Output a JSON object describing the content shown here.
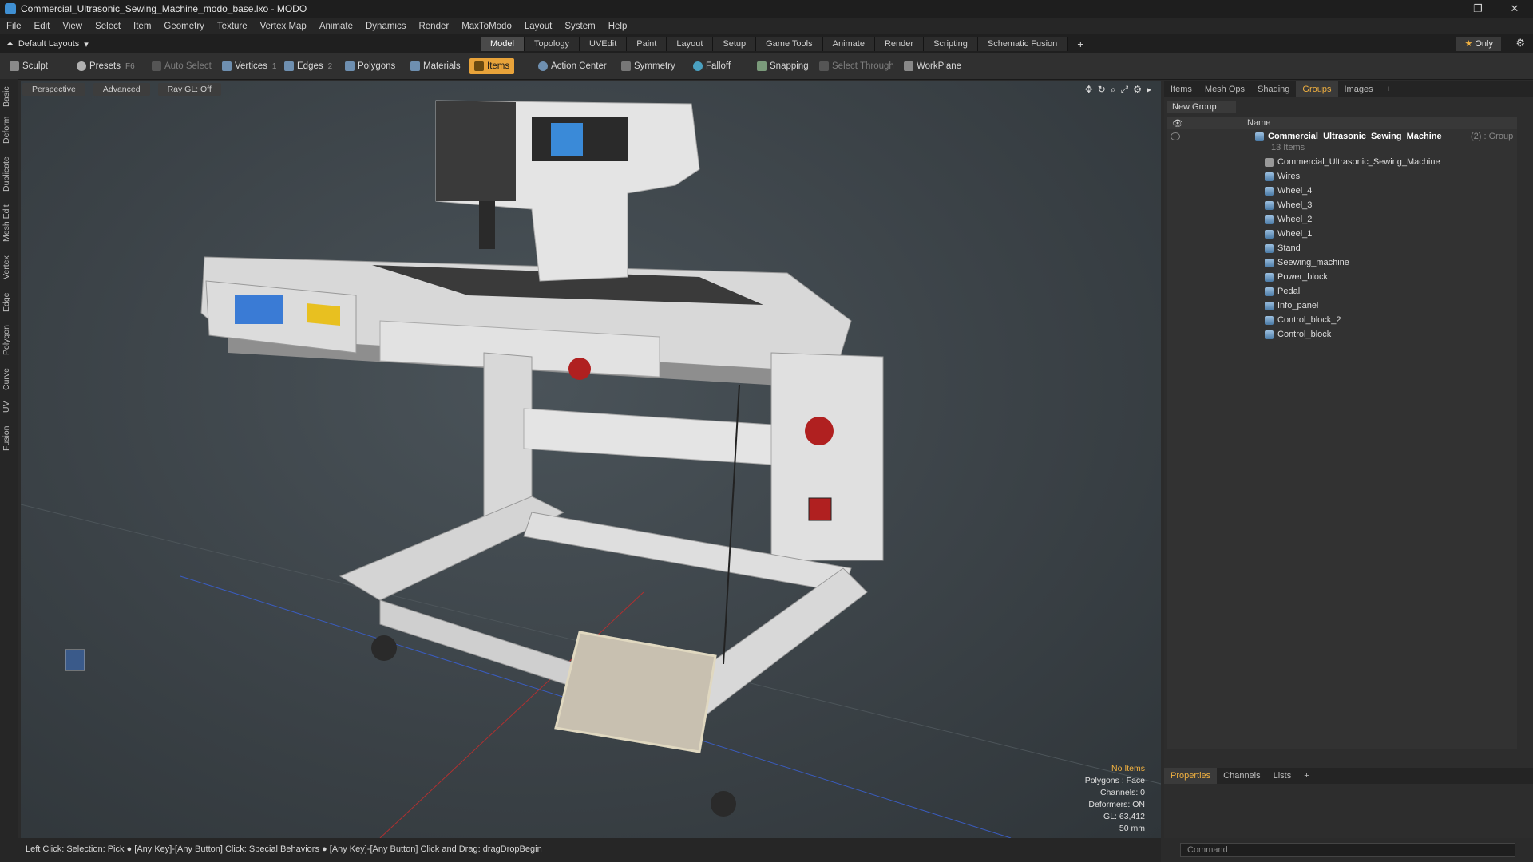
{
  "window": {
    "title": "Commercial_Ultrasonic_Sewing_Machine_modo_base.lxo - MODO"
  },
  "menu": [
    "File",
    "Edit",
    "View",
    "Select",
    "Item",
    "Geometry",
    "Texture",
    "Vertex Map",
    "Animate",
    "Dynamics",
    "Render",
    "MaxToModo",
    "Layout",
    "System",
    "Help"
  ],
  "layout": {
    "selector": "Default Layouts",
    "tabs": [
      "Model",
      "Topology",
      "UVEdit",
      "Paint",
      "Layout",
      "Setup",
      "Game Tools",
      "Animate",
      "Render",
      "Scripting",
      "Schematic Fusion"
    ],
    "active_tab": "Model",
    "only_label": "Only"
  },
  "toolbar": {
    "sculpt": "Sculpt",
    "presets": "Presets",
    "presets_key": "F6",
    "auto_select": "Auto Select",
    "vertices": "Vertices",
    "vertices_key": "1",
    "edges": "Edges",
    "edges_key": "2",
    "polygons": "Polygons",
    "materials": "Materials",
    "items": "Items",
    "action_center": "Action Center",
    "symmetry": "Symmetry",
    "falloff": "Falloff",
    "snapping": "Snapping",
    "select_through": "Select Through",
    "workplane": "WorkPlane"
  },
  "left_tabs": [
    "Basic",
    "Deform",
    "Duplicate",
    "Mesh Edit",
    "Vertex",
    "Edge",
    "Polygon",
    "Curve",
    "UV",
    "Fusion"
  ],
  "viewport": {
    "view": "Perspective",
    "shading": "Advanced",
    "raygl": "Ray GL: Off",
    "info": {
      "no_items": "No Items",
      "polygons": "Polygons : Face",
      "channels": "Channels: 0",
      "deformers": "Deformers: ON",
      "gl": "GL: 63,412",
      "scale": "50 mm"
    }
  },
  "status": "Left Click: Selection: Pick ● [Any Key]-[Any Button] Click: Special Behaviors ● [Any Key]-[Any Button] Click and Drag: dragDropBegin",
  "panel": {
    "tabs": [
      "Items",
      "Mesh Ops",
      "Shading",
      "Groups",
      "Images"
    ],
    "active_tab": "Groups",
    "new_group": "New Group",
    "name_col": "Name",
    "group_name": "Commercial_Ultrasonic_Sewing_Machine",
    "group_suffix": "(2) : Group",
    "group_count": "13 Items",
    "items": [
      "Commercial_Ultrasonic_Sewing_Machine",
      "Wires",
      "Wheel_4",
      "Wheel_3",
      "Wheel_2",
      "Wheel_1",
      "Stand",
      "Seewing_machine",
      "Power_block",
      "Pedal",
      "Info_panel",
      "Control_block_2",
      "Control_block"
    ],
    "bottom_tabs": [
      "Properties",
      "Channels",
      "Lists"
    ],
    "bottom_active": "Properties",
    "command_placeholder": "Command"
  }
}
